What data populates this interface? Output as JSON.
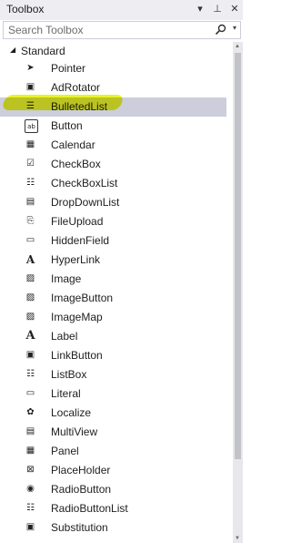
{
  "window": {
    "title": "Toolbox"
  },
  "search": {
    "placeholder": "Search Toolbox"
  },
  "group": {
    "label": "Standard"
  },
  "items": [
    {
      "label": "Pointer",
      "icon": "pointer-icon"
    },
    {
      "label": "AdRotator",
      "icon": "adrotator-icon"
    },
    {
      "label": "BulletedList",
      "icon": "bulleted-list-icon",
      "selected": true
    },
    {
      "label": "Button",
      "icon": "button-icon"
    },
    {
      "label": "Calendar",
      "icon": "calendar-icon"
    },
    {
      "label": "CheckBox",
      "icon": "checkbox-icon"
    },
    {
      "label": "CheckBoxList",
      "icon": "checkbox-list-icon"
    },
    {
      "label": "DropDownList",
      "icon": "dropdown-list-icon"
    },
    {
      "label": "FileUpload",
      "icon": "file-upload-icon"
    },
    {
      "label": "HiddenField",
      "icon": "hidden-field-icon"
    },
    {
      "label": "HyperLink",
      "icon": "hyperlink-icon"
    },
    {
      "label": "Image",
      "icon": "image-icon"
    },
    {
      "label": "ImageButton",
      "icon": "image-button-icon"
    },
    {
      "label": "ImageMap",
      "icon": "image-map-icon"
    },
    {
      "label": "Label",
      "icon": "label-icon"
    },
    {
      "label": "LinkButton",
      "icon": "link-button-icon"
    },
    {
      "label": "ListBox",
      "icon": "listbox-icon"
    },
    {
      "label": "Literal",
      "icon": "literal-icon"
    },
    {
      "label": "Localize",
      "icon": "localize-icon"
    },
    {
      "label": "MultiView",
      "icon": "multiview-icon"
    },
    {
      "label": "Panel",
      "icon": "panel-icon"
    },
    {
      "label": "PlaceHolder",
      "icon": "placeholder-icon"
    },
    {
      "label": "RadioButton",
      "icon": "radio-button-icon"
    },
    {
      "label": "RadioButtonList",
      "icon": "radio-button-list-icon"
    },
    {
      "label": "Substitution",
      "icon": "substitution-icon"
    }
  ],
  "colors": {
    "selected_bg": "#cccedb",
    "highlight": "#e6f000",
    "titlebar": "#eeeef2"
  }
}
